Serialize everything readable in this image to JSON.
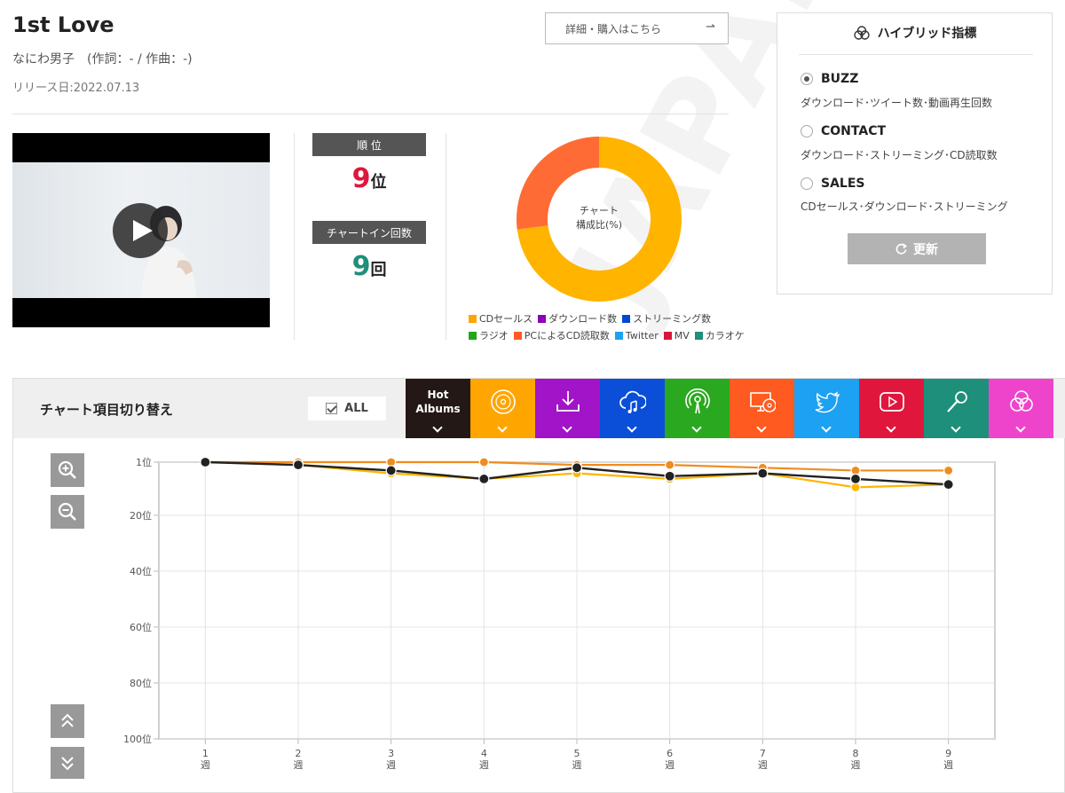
{
  "song": {
    "title": "1st Love",
    "artist_line": "なにわ男子　(作詞：- / 作曲：-)",
    "release": "リリース日:2022.07.13",
    "buy_label": "詳細・購入はこちら"
  },
  "stats": {
    "rank_head": "順 位",
    "rank_value": "9",
    "rank_unit": "位",
    "chartin_head": "チャートイン回数",
    "chartin_value": "9",
    "chartin_unit": "回"
  },
  "donut": {
    "label_line1": "チャート",
    "label_line2": "構成比(%)",
    "segments": [
      {
        "name": "CDセールス",
        "percent": 73,
        "color": "#ffb400"
      },
      {
        "name": "PCによるCD読取数",
        "percent": 27,
        "color": "#ff6b35"
      }
    ]
  },
  "legend": [
    {
      "label": "CDセールス",
      "color": "#ffa500"
    },
    {
      "label": "ダウンロード数",
      "color": "#8b00b8"
    },
    {
      "label": "ストリーミング数",
      "color": "#0047d6"
    },
    {
      "label": "ラジオ",
      "color": "#22a61b"
    },
    {
      "label": "PCによるCD読取数",
      "color": "#ff5a1f"
    },
    {
      "label": "Twitter",
      "color": "#1da1f2"
    },
    {
      "label": "MV",
      "color": "#d8163a"
    },
    {
      "label": "カラオケ",
      "color": "#1e8f7a"
    }
  ],
  "hybrid": {
    "title": "ハイブリッド指標",
    "options": [
      {
        "label": "BUZZ",
        "desc": "ダウンロード･ツイート数･動画再生回数",
        "selected": true
      },
      {
        "label": "CONTACT",
        "desc": "ダウンロード･ストリーミング･CD読取数",
        "selected": false
      },
      {
        "label": "SALES",
        "desc": "CDセールス･ダウンロード･ストリーミング",
        "selected": false
      }
    ],
    "update_label": "更新"
  },
  "switcher": {
    "label": "チャート項目切り替え",
    "all_label": "ALL",
    "hot_line1": "Hot",
    "hot_line2": "Albums",
    "categories": [
      {
        "name": "cd-sales",
        "color": "#ffa500",
        "icon": "disc-icon"
      },
      {
        "name": "download",
        "color": "#a114c8",
        "icon": "download-icon"
      },
      {
        "name": "streaming",
        "color": "#0b4fd8",
        "icon": "cloud-music-icon"
      },
      {
        "name": "radio",
        "color": "#2aa81f",
        "icon": "radio-icon"
      },
      {
        "name": "pc-cd-read",
        "color": "#ff5a1f",
        "icon": "pc-disc-icon"
      },
      {
        "name": "twitter",
        "color": "#1da1f2",
        "icon": "twitter-icon"
      },
      {
        "name": "mv",
        "color": "#e0163d",
        "icon": "video-play-icon"
      },
      {
        "name": "karaoke",
        "color": "#1e8f7a",
        "icon": "microphone-icon"
      },
      {
        "name": "hybrid",
        "color": "#ee44cc",
        "icon": "hybrid-icon"
      }
    ],
    "hot_color": "#231815"
  },
  "chart_data": {
    "type": "line",
    "x": [
      1,
      2,
      3,
      4,
      5,
      6,
      7,
      8,
      9
    ],
    "x_tick_labels": [
      "1週",
      "2週",
      "3週",
      "4週",
      "5週",
      "6週",
      "7週",
      "8週",
      "9週"
    ],
    "y_tick_labels": [
      "1位",
      "20位",
      "40位",
      "60位",
      "80位",
      "100位"
    ],
    "y_ticks": [
      1,
      20,
      40,
      60,
      80,
      100
    ],
    "ylim": [
      1,
      100
    ],
    "y_inverted": true,
    "grid": true,
    "series": [
      {
        "color": "#ffb400",
        "values": [
          1,
          2,
          5,
          7,
          5,
          7,
          5,
          10,
          9
        ]
      },
      {
        "color": "#f08c1e",
        "values": [
          1,
          1,
          1,
          1,
          2,
          2,
          3,
          4,
          4
        ]
      },
      {
        "color": "#222222",
        "values": [
          1,
          2,
          4,
          7,
          3,
          6,
          5,
          7,
          9
        ]
      }
    ]
  }
}
